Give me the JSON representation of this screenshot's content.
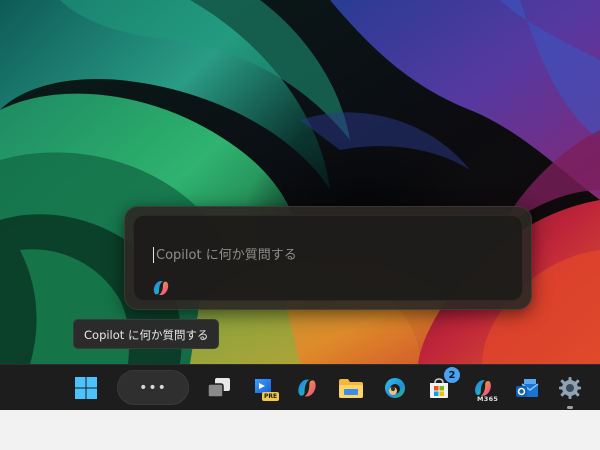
{
  "copilot": {
    "placeholder": "Copilot に何か質問する",
    "tooltip": "Copilot に何か質問する"
  },
  "taskbar": {
    "search_dots": "•••",
    "store_badge": "2",
    "dev_preview_tag": "PRE",
    "m365_tag": "M365"
  },
  "colors": {
    "taskbar_bg": "#1d1d1d",
    "flyout_bg": "#2d2824",
    "accent_blue": "#4aa3f0"
  },
  "icons": {
    "start": "windows-logo-icon",
    "task_view": "task-view-icon",
    "dev_preview": "visual-studio-preview-icon",
    "copilot": "copilot-icon",
    "explorer": "folder-icon",
    "edge": "edge-icon",
    "store": "store-icon",
    "m365": "m365-copilot-icon",
    "outlook": "outlook-icon",
    "settings": "gear-icon"
  }
}
